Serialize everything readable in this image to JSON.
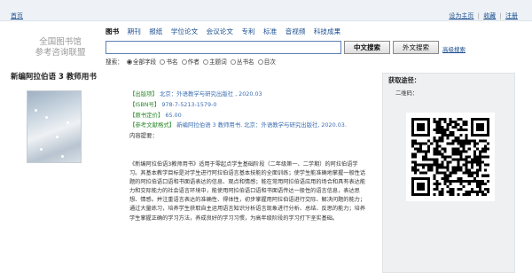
{
  "topbar": {
    "home": "首页",
    "links": [
      "设为主页",
      "收藏",
      "注册"
    ]
  },
  "logo": {
    "line1": "全国图书馆",
    "line2": "参考咨询联盟"
  },
  "tabs": [
    "图书",
    "期刊",
    "报纸",
    "学位论文",
    "会议论文",
    "专利",
    "标准",
    "音视频",
    "科技成果"
  ],
  "search": {
    "value": "",
    "btn_cn": "中文搜索",
    "btn_en": "外文搜索",
    "advanced": "高级搜索",
    "label": "搜索：",
    "options": [
      "全部字段",
      "书名",
      "作者",
      "主题词",
      "丛书名",
      "目次"
    ]
  },
  "book": {
    "title": "新编阿拉伯语 3 教师用书",
    "publisher_label": "【出版项】",
    "publisher": "北京：外语教学与研究出版社 , 2020.03",
    "isbn_label": "【ISBN号】",
    "isbn": "978-7-5213-1579-0",
    "price_label": "【原书定价】",
    "price": "65.00",
    "ref_label": "【参考文献格式】",
    "ref": "新编阿拉伯语 3 教师用书. 北京：外语教学与研究出版社, 2020.03.",
    "intro_label": "内容提要：",
    "intro": "《新编阿拉伯语3教师用书》适用于零起点学生基础阶段（二年级第一、二学期）的阿拉伯语学习。其基本教学目标是对学生进行阿拉伯语言基本技能的全面训练；使学生能准确地掌握一般性话题的阿拉伯语口语和书面语表达的信息、观点和情感；能在常用阿拉伯语应用的场合和具有表达能力和交际能力的社会语言环境中，能使用阿拉伯语口语和书面语传达一般性的语言信息，表达思想、情感。并注重语言表达的准确性、得体性，初步掌握用阿拉伯语进行交际、解决问题的能力；通过大量练习，培养学生获取自主运用语言知识分析语言现象进行分析、总结、反思的能力；培养学生掌握正确的学习方法，养成良好的学习习惯，为高年级阶段的学习打下坚实基础。"
  },
  "sidebar": {
    "heading": "获取途径：",
    "qr_label": "二维码："
  }
}
